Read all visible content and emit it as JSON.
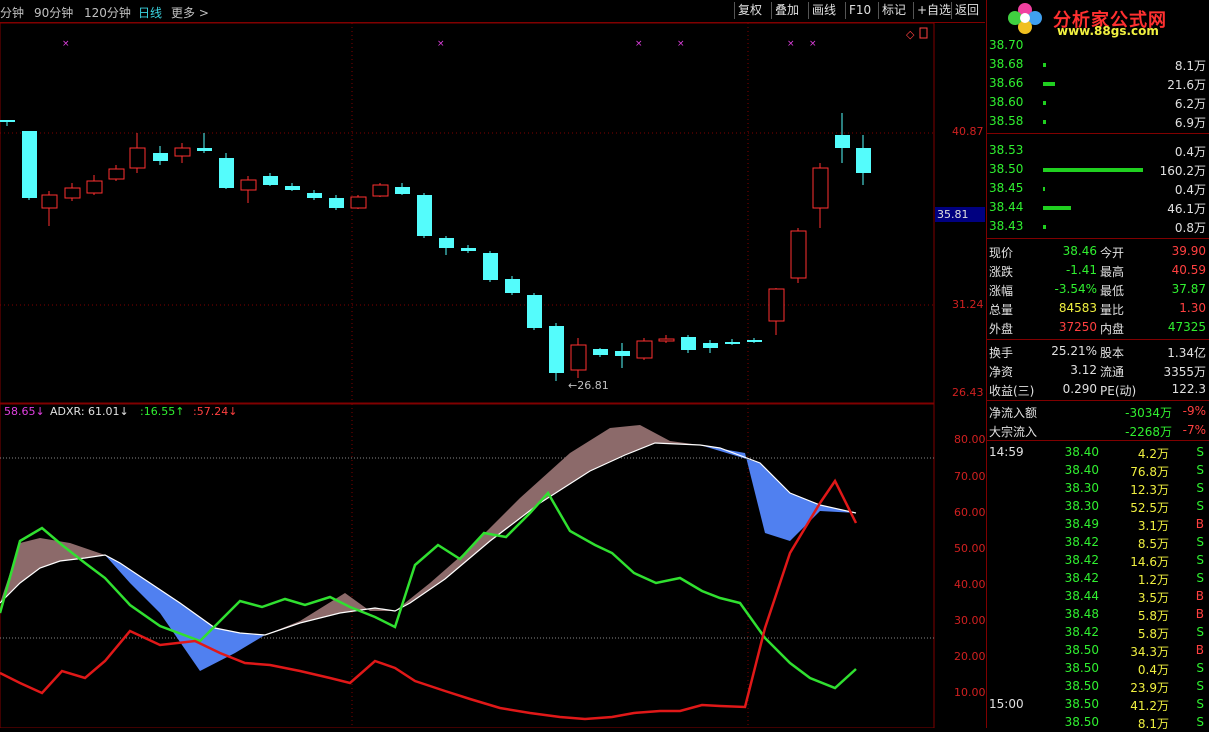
{
  "topbar": {
    "timeframes": [
      "分钟",
      "90分钟",
      "120分钟",
      "日线",
      "更多 >"
    ],
    "active_index": 3,
    "buttons": [
      "复权",
      "叠加",
      "画线",
      "F10",
      "标记",
      "+自选",
      "返回"
    ]
  },
  "price_chart": {
    "y_labels": [
      "40.87",
      "35.81",
      "31.24",
      "26.43"
    ],
    "current_marker": "35.81",
    "low_label": "←26.81",
    "marker_glyph": "×"
  },
  "indicator": {
    "legend": [
      {
        "text": "58.65↓",
        "color": "#e040e0"
      },
      {
        "text": "ADXR: 61.01↓",
        "color": "#e0e0e0"
      },
      {
        "text": ":16.55↑",
        "color": "#30f030"
      },
      {
        "text": ":57.24↓",
        "color": "#ff4040"
      }
    ],
    "y_labels": [
      "80.00",
      "70.00",
      "60.00",
      "50.00",
      "40.00",
      "30.00",
      "20.00",
      "10.00"
    ]
  },
  "logo": {
    "title": "分析家公式网",
    "url": "www.88gs.com"
  },
  "order_book": {
    "sells": [
      {
        "price": "38.70",
        "vol": ""
      },
      {
        "price": "38.68",
        "vol": "8.1万"
      },
      {
        "price": "38.66",
        "vol": "21.6万"
      },
      {
        "price": "38.60",
        "vol": "6.2万"
      },
      {
        "price": "38.58",
        "vol": "6.9万"
      }
    ],
    "buys": [
      {
        "price": "38.53",
        "vol": "0.4万"
      },
      {
        "price": "38.50",
        "vol": "160.2万"
      },
      {
        "price": "38.45",
        "vol": "0.4万"
      },
      {
        "price": "38.44",
        "vol": "46.1万"
      },
      {
        "price": "38.43",
        "vol": "0.8万"
      }
    ]
  },
  "quote": {
    "rows": [
      {
        "l1": "现价",
        "v1": "38.46",
        "c1": "g",
        "l2": "今开",
        "v2": "39.90",
        "c2": "r"
      },
      {
        "l1": "涨跌",
        "v1": "-1.41",
        "c1": "g",
        "l2": "最高",
        "v2": "40.59",
        "c2": "r"
      },
      {
        "l1": "涨幅",
        "v1": "-3.54%",
        "c1": "g",
        "l2": "最低",
        "v2": "37.87",
        "c2": "g"
      },
      {
        "l1": "总量",
        "v1": "84583",
        "c1": "y",
        "l2": "量比",
        "v2": "1.30",
        "c2": "r"
      },
      {
        "l1": "外盘",
        "v1": "37250",
        "c1": "r",
        "l2": "内盘",
        "v2": "47325",
        "c2": "g"
      }
    ],
    "rows2": [
      {
        "l1": "换手",
        "v1": "25.21%",
        "l2": "股本",
        "v2": "1.34亿"
      },
      {
        "l1": "净资",
        "v1": "3.12",
        "l2": "流通",
        "v2": "3355万"
      },
      {
        "l1": "收益(三)",
        "v1": "0.290",
        "l2": "PE(动)",
        "v2": "122.3"
      }
    ],
    "flows": [
      {
        "label": "净流入额",
        "value": "-3034万",
        "pct": "-9%"
      },
      {
        "label": "大宗流入",
        "value": "-2268万",
        "pct": "-7%"
      }
    ]
  },
  "ticks": [
    {
      "time": "14:59",
      "price": "38.40",
      "vol": "4.2万",
      "side": "S"
    },
    {
      "time": "",
      "price": "38.40",
      "vol": "76.8万",
      "side": "S"
    },
    {
      "time": "",
      "price": "38.30",
      "vol": "12.3万",
      "side": "S"
    },
    {
      "time": "",
      "price": "38.30",
      "vol": "52.5万",
      "side": "S"
    },
    {
      "time": "",
      "price": "38.49",
      "vol": "3.1万",
      "side": "B"
    },
    {
      "time": "",
      "price": "38.42",
      "vol": "8.5万",
      "side": "S"
    },
    {
      "time": "",
      "price": "38.42",
      "vol": "14.6万",
      "side": "S"
    },
    {
      "time": "",
      "price": "38.42",
      "vol": "1.2万",
      "side": "S"
    },
    {
      "time": "",
      "price": "38.44",
      "vol": "3.5万",
      "side": "B"
    },
    {
      "time": "",
      "price": "38.48",
      "vol": "5.8万",
      "side": "B"
    },
    {
      "time": "",
      "price": "38.42",
      "vol": "5.8万",
      "side": "S"
    },
    {
      "time": "",
      "price": "38.50",
      "vol": "34.3万",
      "side": "B"
    },
    {
      "time": "",
      "price": "38.50",
      "vol": "0.4万",
      "side": "S"
    },
    {
      "time": "",
      "price": "38.50",
      "vol": "23.9万",
      "side": "S"
    },
    {
      "time": "15:00",
      "price": "38.50",
      "vol": "41.2万",
      "side": "S"
    },
    {
      "time": "",
      "price": "38.50",
      "vol": "8.1万",
      "side": "S"
    }
  ],
  "colors": {
    "up": "#ff3030",
    "down": "#54fcfc",
    "frame": "#800000",
    "green": "#30f030",
    "red": "#ff3030"
  }
}
